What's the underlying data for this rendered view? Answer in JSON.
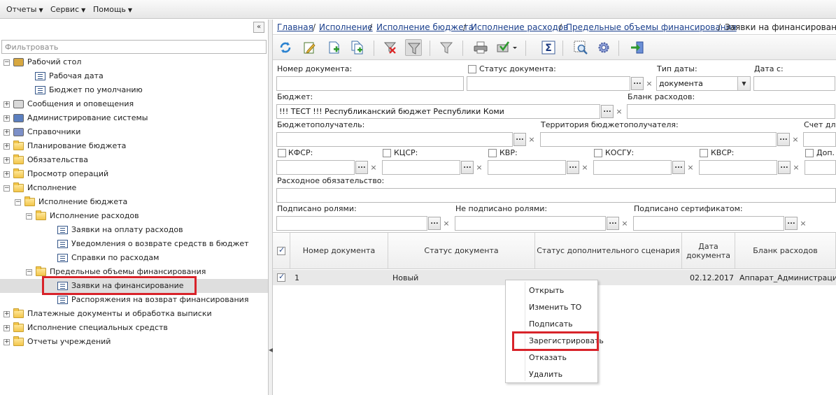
{
  "menubar": {
    "items": [
      {
        "label": "Отчеты"
      },
      {
        "label": "Сервис"
      },
      {
        "label": "Помощь"
      }
    ]
  },
  "leftpanel": {
    "collapse_glyph": "«",
    "filter_placeholder": "Фильтровать",
    "tree": [
      {
        "label": "Рабочий стол",
        "level": 0,
        "expander": "−",
        "icon": "desk-icon"
      },
      {
        "label": "Рабочая дата",
        "level": 1,
        "icon": "doc-icon"
      },
      {
        "label": "Бюджет по умолчанию",
        "level": 1,
        "icon": "doc-icon"
      },
      {
        "label": "Сообщения и оповещения",
        "level": 0,
        "expander": "+",
        "icon": "message-icon"
      },
      {
        "label": "Администрирование системы",
        "level": 0,
        "expander": "+",
        "icon": "computer-icon"
      },
      {
        "label": "Справочники",
        "level": 0,
        "expander": "+",
        "icon": "books-icon"
      },
      {
        "label": "Планирование бюджета",
        "level": 0,
        "expander": "+",
        "icon": "folder-icon"
      },
      {
        "label": "Обязательства",
        "level": 0,
        "expander": "+",
        "icon": "folder-icon"
      },
      {
        "label": "Просмотр операций",
        "level": 0,
        "expander": "+",
        "icon": "folder-icon"
      },
      {
        "label": "Исполнение",
        "level": 0,
        "expander": "−",
        "icon": "folder-icon"
      },
      {
        "label": "Исполнение бюджета",
        "level": 1,
        "expander": "−",
        "icon": "folder-icon"
      },
      {
        "label": "Исполнение расходов",
        "level": 2,
        "expander": "−",
        "icon": "folder-icon"
      },
      {
        "label": "Заявки на оплату расходов",
        "level": 3,
        "icon": "doc-icon"
      },
      {
        "label": "Уведомления о возврате средств в бюджет",
        "level": 3,
        "icon": "doc-icon"
      },
      {
        "label": "Справки по расходам",
        "level": 3,
        "icon": "doc-icon"
      },
      {
        "label": "Предельные объемы финансирования",
        "level": 2,
        "expander": "−",
        "icon": "folder-icon"
      },
      {
        "label": "Заявки на финансирование",
        "level": 3,
        "icon": "doc-icon",
        "selected": true
      },
      {
        "label": "Распоряжения на возврат финансирования",
        "level": 3,
        "icon": "doc-icon"
      },
      {
        "label": "Платежные документы и обработка выписки",
        "level": 0,
        "expander": "+",
        "icon": "folder-icon"
      },
      {
        "label": "Исполнение специальных средств",
        "level": 0,
        "expander": "+",
        "icon": "folder-icon"
      },
      {
        "label": "Отчеты учреждений",
        "level": 0,
        "expander": "+",
        "icon": "folder-icon"
      }
    ]
  },
  "breadcrumb": {
    "links": [
      "Главная",
      "Исполнение",
      "Исполнение бюджета",
      "Исполнение расходов",
      "Предельные объемы финансирования"
    ],
    "separator": "/",
    "current": "Заявки на финансирование"
  },
  "toolbar": {
    "buttons": [
      {
        "name": "refresh-button",
        "icon": "refresh-icon"
      },
      {
        "name": "edit-button",
        "icon": "edit-icon"
      },
      {
        "name": "create-button",
        "icon": "new-doc-icon"
      },
      {
        "name": "copy-button",
        "icon": "copy-doc-icon"
      },
      {
        "name": "clear-filter-button",
        "icon": "filter-clear-icon"
      },
      {
        "name": "filter-toggle-button",
        "icon": "filter-icon",
        "pressed": true
      },
      {
        "name": "filter-options-button",
        "icon": "filter-alt-icon"
      },
      {
        "name": "print-button",
        "icon": "printer-icon"
      },
      {
        "name": "signature-button",
        "icon": "sign-icon"
      },
      {
        "name": "sum-button",
        "icon": "sigma-icon"
      },
      {
        "name": "preview-button",
        "icon": "magnify-icon"
      },
      {
        "name": "settings-button",
        "icon": "gear-icon"
      },
      {
        "name": "exit-button",
        "icon": "exit-icon"
      }
    ]
  },
  "filters": {
    "doc_number_label": "Номер документа:",
    "doc_status_label": "Статус документа:",
    "date_type_label": "Тип даты:",
    "date_type_value": "документа",
    "date_from_label": "Дата с:",
    "budget_label": "Бюджет:",
    "budget_value": "!!! ТЕСТ !!! Республиканский бюджет Республики Коми",
    "expense_form_label": "Бланк расходов:",
    "recipient_label": "Бюджетополучатель:",
    "territory_label": "Территория бюджетополучателя:",
    "account_label": "Счет для",
    "kfsr_label": "КФСР:",
    "kcsr_label": "КЦСР:",
    "kvr_label": "КВР:",
    "kosgu_label": "КОСГУ:",
    "kvsr_label": "КВСР:",
    "extra_label": "Доп.",
    "obligation_label": "Расходное обязательство:",
    "signed_roles_label": "Подписано ролями:",
    "unsigned_roles_label": "Не подписано ролями:",
    "signed_cert_label": "Подписано сертификатом:",
    "dots": "...",
    "clear": "×"
  },
  "grid": {
    "columns": [
      "Номер документа",
      "Статус документа",
      "Статус дополнительного сценария",
      "Дата документа",
      "Бланк расходов"
    ],
    "rows": [
      {
        "number": "1",
        "status": "Новый",
        "extra_status": "",
        "date": "02.12.2017",
        "expense_form": "Аппарат_Администрация Г"
      }
    ]
  },
  "context_menu": {
    "items": [
      "Открыть",
      "Изменить ТО",
      "Подписать",
      "Зарегистрировать",
      "Отказать",
      "Удалить"
    ],
    "highlighted": "Зарегистрировать"
  },
  "colors": {
    "link": "#1a3f8c",
    "highlight_box": "#d8232a",
    "selected_row": "#dedede",
    "grid_row": "#e8e8e8"
  }
}
